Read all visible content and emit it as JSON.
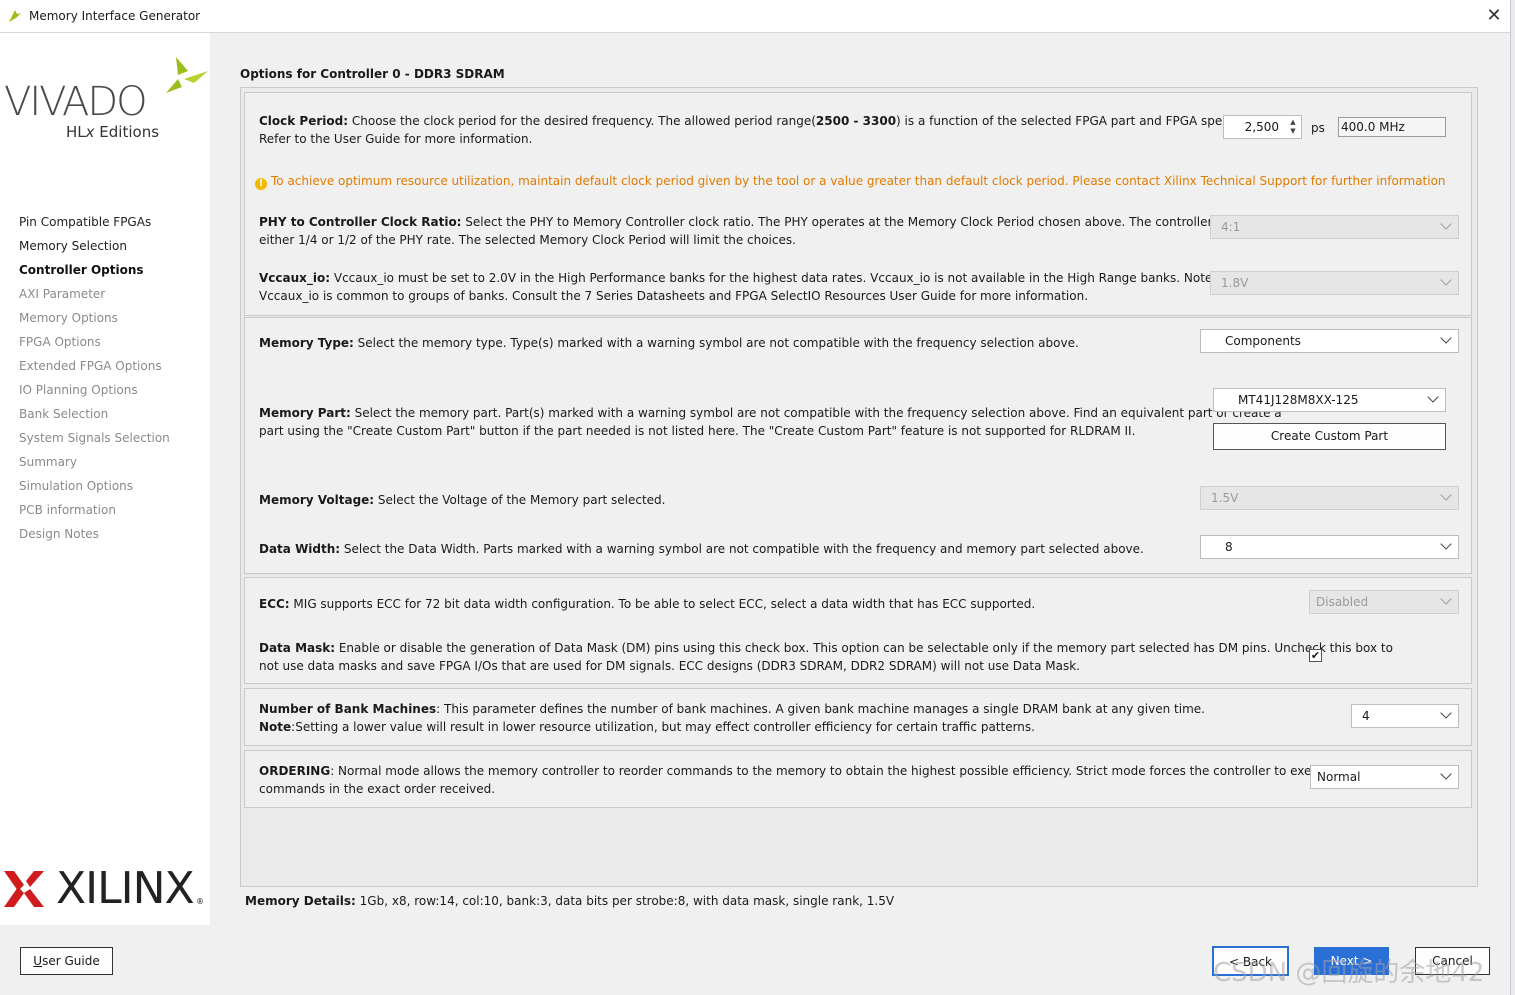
{
  "window": {
    "title": "Memory Interface Generator",
    "close_glyph": "✕"
  },
  "brand": {
    "vivado": "VIVADO",
    "vivado_sub_prefix": "HL",
    "vivado_sub_x": "x",
    "vivado_sub_suffix": " Editions",
    "xilinx": "XILINX",
    "xilinx_reg": "®"
  },
  "sidebar": {
    "items": [
      {
        "label": "Pin Compatible FPGAs",
        "state": "enabled"
      },
      {
        "label": "Memory Selection",
        "state": "enabled"
      },
      {
        "label": "Controller Options",
        "state": "active"
      },
      {
        "label": "AXI Parameter",
        "state": "disabled"
      },
      {
        "label": "Memory Options",
        "state": "disabled"
      },
      {
        "label": "FPGA Options",
        "state": "disabled"
      },
      {
        "label": "Extended FPGA Options",
        "state": "disabled"
      },
      {
        "label": "IO Planning Options",
        "state": "disabled"
      },
      {
        "label": "Bank Selection",
        "state": "disabled"
      },
      {
        "label": "System Signals Selection",
        "state": "disabled"
      },
      {
        "label": "Summary",
        "state": "disabled"
      },
      {
        "label": "Simulation Options",
        "state": "disabled"
      },
      {
        "label": "PCB information",
        "state": "disabled"
      },
      {
        "label": "Design Notes",
        "state": "disabled"
      }
    ]
  },
  "main": {
    "section_title": "Options for Controller 0 - DDR3 SDRAM",
    "clock": {
      "label": "Clock Period:",
      "text1": " Choose the clock period for the desired frequency. The allowed period range(",
      "range": "2500 - 3300",
      "text2": ") is a function of the selected FPGA part and FPGA speed grade.",
      "line2": "Refer to the User Guide for more information.",
      "value": "2,500",
      "unit": "ps",
      "freq": "400.0 MHz"
    },
    "warning": "To achieve optimum resource utilization, maintain default clock period given by the tool or a value greater than default clock period. Please contact Xilinx Technical Support for further information",
    "phy": {
      "label": "PHY to Controller Clock Ratio:",
      "line1": " Select the PHY to Memory Controller clock ratio. The PHY operates at the Memory Clock Period chosen above. The controller operates at",
      "line2": "either 1/4 or 1/2 of the PHY rate. The selected Memory Clock Period will limit the choices.",
      "value": "4:1"
    },
    "vccaux": {
      "label": "Vccaux_io:",
      "line1": " Vccaux_io must be set to 2.0V in the High Performance banks for the highest data rates. Vccaux_io is not available in the High Range banks. Note that",
      "line2": "Vccaux_io is common to groups of banks. Consult the 7 Series Datasheets and FPGA SelectIO Resources User Guide for more information.",
      "value": "1.8V"
    },
    "memory_type": {
      "label": "Memory Type:",
      "text": " Select the memory type. Type(s) marked with a warning symbol are not compatible with the frequency selection above.",
      "value": "Components"
    },
    "memory_part": {
      "label": "Memory Part:",
      "line1": " Select the memory part. Part(s) marked with a warning symbol are not compatible with the frequency selection above. Find an equivalent part or create a",
      "line2": "part using the \"Create Custom Part\" button if the part needed is not listed here. The \"Create Custom Part\" feature is not supported for RLDRAM II.",
      "value": "MT41J128M8XX-125",
      "button": "Create Custom Part"
    },
    "memory_voltage": {
      "label": "Memory Voltage:",
      "text": " Select the Voltage of the Memory part selected.",
      "value": "1.5V"
    },
    "data_width": {
      "label": "Data Width:",
      "text": " Select the Data Width. Parts marked with a warning symbol are not compatible with the frequency and memory part selected above.",
      "value": "8"
    },
    "ecc": {
      "label": "ECC:",
      "text": " MIG supports ECC for 72 bit data width configuration. To be able to select ECC, select a data width that has ECC supported.",
      "value": "Disabled"
    },
    "data_mask": {
      "label": "Data Mask:",
      "line1": " Enable or disable the generation of Data Mask (DM) pins using this check box. This option can be selectable only if the memory part selected has DM pins. Uncheck this box to",
      "line2": "not use data masks and save FPGA I/Os that are used for DM signals. ECC designs (DDR3 SDRAM, DDR2 SDRAM) will not use Data Mask.",
      "checked": true,
      "check_glyph": "✔"
    },
    "bank_machines": {
      "label": "Number of Bank Machines",
      "line1": ": This parameter defines the number of bank machines. A given bank machine manages a single DRAM bank at any given time.",
      "note_label": "Note",
      "note": ":Setting a lower value will result in lower resource utilization, but may effect controller efficiency for certain traffic patterns.",
      "value": "4"
    },
    "ordering": {
      "label": "ORDERING",
      "line1": ": Normal mode allows the memory controller to reorder commands to the memory to obtain the highest possible efficiency. Strict mode forces the controller to execute",
      "line2": "commands in the exact order received.",
      "value": "Normal"
    },
    "details": {
      "label": "Memory Details:",
      "text": " 1Gb, x8, row:14, col:10, bank:3, data bits per strobe:8, with data mask, single rank, 1.5V"
    }
  },
  "footer": {
    "user_guide_u": "U",
    "user_guide_rest": "ser Guide",
    "back": "< Back",
    "next": "Next >",
    "cancel": "Cancel"
  },
  "watermark": "CSDN @回旋的余地42",
  "colors": {
    "warning": "#e07b00",
    "primary_button": "#2a6fd6",
    "logo_green": "#9bbf1a",
    "xilinx_red": "#d01c1f"
  }
}
